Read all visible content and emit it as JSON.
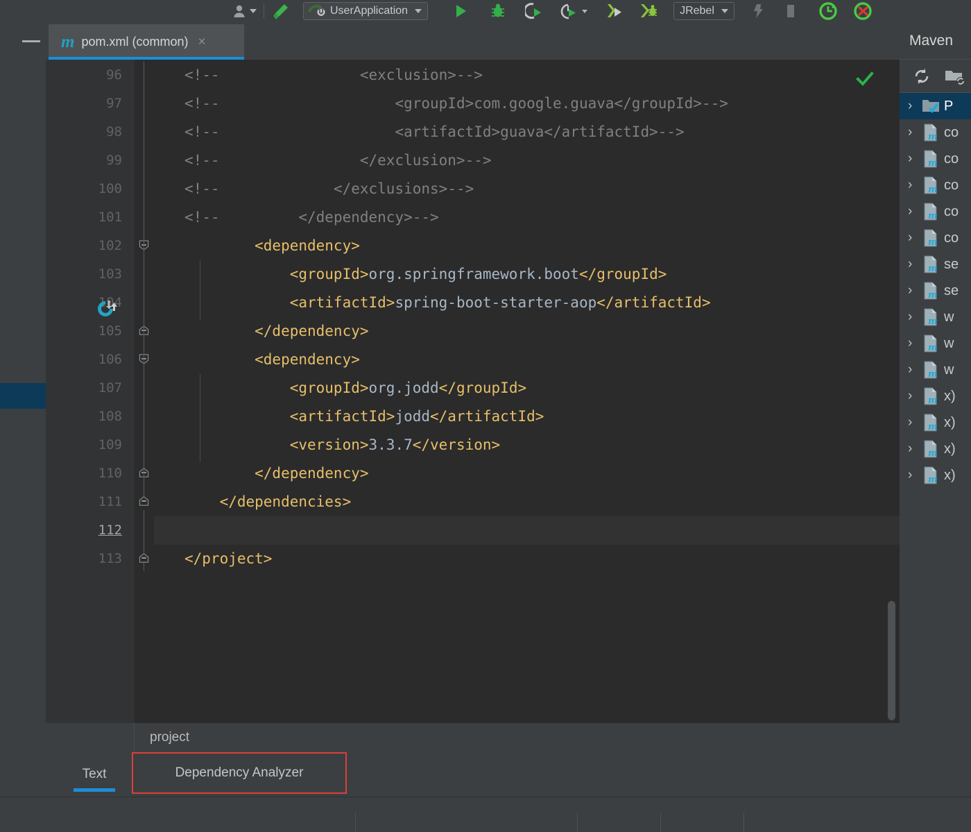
{
  "app": {
    "theme_bg": "#3c3f41",
    "editor_bg": "#2b2b2b",
    "accent": "#1a8ed8",
    "highlight_box": "#d9403a"
  },
  "toolbar": {
    "profile_icon": "user-silhouette-icon",
    "build_icon": "hammer-icon",
    "run_configuration": {
      "name": "UserApplication",
      "icon": "spring-boot-icon"
    },
    "run_icon": "run-play-icon",
    "debug_icon": "debug-bug-icon",
    "run_with_coverage_icon": "run-coverage-icon",
    "profiler_icon": "profiler-icon",
    "attach_icon": "attach-process-icon",
    "debug_attach_icon": "debug-attach-icon",
    "jrebel": {
      "label": "JRebel"
    },
    "jrebel_run_icon": "jrebel-run-icon",
    "jrebel_stop_icon": "jrebel-stop-icon",
    "reload_icon": "reload-green-icon",
    "reload_off_icon": "reload-disabled-icon"
  },
  "tab_bar": {
    "collapse_icon": "minimize-icon",
    "tabs": [
      {
        "icon": "maven-m-icon",
        "title": "pom.xml (common)",
        "close": "×",
        "active": true
      }
    ]
  },
  "editor": {
    "inspection_status_icon": "inspection-ok-check-icon",
    "gutter_maven_icon": "maven-reload-project-icon",
    "current_line": 112,
    "first_line": 96,
    "lines": [
      {
        "n": 96,
        "segments": [
          {
            "t": "<!--",
            "c": "cmt"
          },
          {
            "t": "                <exclusion>-->",
            "c": "cmt"
          }
        ]
      },
      {
        "n": 97,
        "segments": [
          {
            "t": "<!--",
            "c": "cmt"
          },
          {
            "t": "                    <groupId>com.google.guava</groupId>-->",
            "c": "cmt"
          }
        ]
      },
      {
        "n": 98,
        "segments": [
          {
            "t": "<!--",
            "c": "cmt"
          },
          {
            "t": "                    <artifactId>guava</artifactId>-->",
            "c": "cmt"
          }
        ]
      },
      {
        "n": 99,
        "segments": [
          {
            "t": "<!--",
            "c": "cmt"
          },
          {
            "t": "                </exclusion>-->",
            "c": "cmt"
          }
        ]
      },
      {
        "n": 100,
        "segments": [
          {
            "t": "<!--",
            "c": "cmt"
          },
          {
            "t": "             </exclusions>-->",
            "c": "cmt"
          }
        ]
      },
      {
        "n": 101,
        "segments": [
          {
            "t": "<!--",
            "c": "cmt"
          },
          {
            "t": "         </dependency>-->",
            "c": "cmt"
          }
        ]
      },
      {
        "n": 102,
        "segments": [
          {
            "t": "        <dependency>",
            "c": "tag"
          }
        ]
      },
      {
        "n": 103,
        "segments": [
          {
            "t": "            <groupId>",
            "c": "tag"
          },
          {
            "t": "org.springframework.boot",
            "c": "val"
          },
          {
            "t": "</groupId>",
            "c": "tag"
          }
        ]
      },
      {
        "n": 104,
        "segments": [
          {
            "t": "            <artifactId>",
            "c": "tag"
          },
          {
            "t": "spring-boot-starter-aop",
            "c": "val"
          },
          {
            "t": "</artifactId>",
            "c": "tag"
          }
        ]
      },
      {
        "n": 105,
        "segments": [
          {
            "t": "        </dependency>",
            "c": "tag"
          }
        ]
      },
      {
        "n": 106,
        "segments": [
          {
            "t": "        <dependency>",
            "c": "tag"
          }
        ]
      },
      {
        "n": 107,
        "segments": [
          {
            "t": "            <groupId>",
            "c": "tag"
          },
          {
            "t": "org.jodd",
            "c": "val"
          },
          {
            "t": "</groupId>",
            "c": "tag"
          }
        ]
      },
      {
        "n": 108,
        "segments": [
          {
            "t": "            <artifactId>",
            "c": "tag"
          },
          {
            "t": "jodd",
            "c": "val"
          },
          {
            "t": "</artifactId>",
            "c": "tag"
          }
        ]
      },
      {
        "n": 109,
        "segments": [
          {
            "t": "            <version>",
            "c": "tag"
          },
          {
            "t": "3.3.7",
            "c": "val"
          },
          {
            "t": "</version>",
            "c": "tag"
          }
        ]
      },
      {
        "n": 110,
        "segments": [
          {
            "t": "        </dependency>",
            "c": "tag"
          }
        ]
      },
      {
        "n": 111,
        "segments": [
          {
            "t": "    </dependencies>",
            "c": "tag"
          }
        ]
      },
      {
        "n": 112,
        "segments": [
          {
            "t": "",
            "c": "val"
          }
        ]
      },
      {
        "n": 113,
        "segments": [
          {
            "t": "</project>",
            "c": "tag"
          }
        ]
      }
    ]
  },
  "breadcrumb": {
    "path": "project"
  },
  "bottom_tabs": [
    {
      "label": "Text",
      "active": true,
      "highlighted": false
    },
    {
      "label": "Dependency Analyzer",
      "active": false,
      "highlighted": true
    }
  ],
  "maven_panel": {
    "title": "Maven",
    "toolbar": [
      {
        "icon": "reload-all-maven-projects-icon"
      },
      {
        "icon": "add-maven-project-icon"
      }
    ],
    "tree": [
      {
        "icon": "maven-project-root-icon",
        "label": "P",
        "selected": true
      },
      {
        "icon": "maven-module-icon",
        "label": "co",
        "selected": false
      },
      {
        "icon": "maven-module-icon",
        "label": "co",
        "selected": false
      },
      {
        "icon": "maven-module-icon",
        "label": "co",
        "selected": false
      },
      {
        "icon": "maven-module-icon",
        "label": "co",
        "selected": false
      },
      {
        "icon": "maven-module-icon",
        "label": "co",
        "selected": false
      },
      {
        "icon": "maven-module-icon",
        "label": "se",
        "selected": false
      },
      {
        "icon": "maven-module-icon",
        "label": "se",
        "selected": false
      },
      {
        "icon": "maven-module-icon",
        "label": "w",
        "selected": false
      },
      {
        "icon": "maven-module-icon",
        "label": "w",
        "selected": false
      },
      {
        "icon": "maven-module-icon",
        "label": "w",
        "selected": false
      },
      {
        "icon": "maven-module-icon",
        "label": "x)",
        "selected": false
      },
      {
        "icon": "maven-module-icon",
        "label": "x)",
        "selected": false
      },
      {
        "icon": "maven-module-icon",
        "label": "x)",
        "selected": false
      },
      {
        "icon": "maven-module-icon",
        "label": "x)",
        "selected": false
      }
    ]
  }
}
